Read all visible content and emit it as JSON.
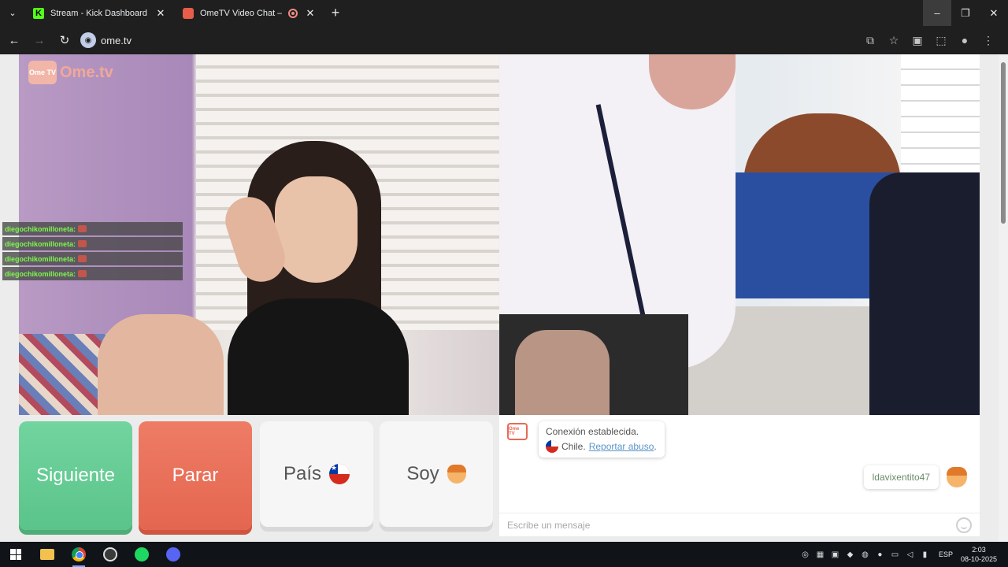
{
  "browser": {
    "tabs": [
      {
        "title": "Stream - Kick Dashboard",
        "favicon": "kick-icon"
      },
      {
        "title": "OmeTV Video Chat — Ome",
        "favicon": "ometv-icon",
        "recording": true
      }
    ],
    "url": "ome.tv",
    "window_controls": {
      "minimize": "–",
      "restore": "❐",
      "close": "✕"
    }
  },
  "page": {
    "logo": {
      "badge": "Ome TV",
      "wordmark": "Ome.tv"
    },
    "overlay_chat": [
      {
        "user": "diegochikomilloneta:"
      },
      {
        "user": "diegochikomilloneta:"
      },
      {
        "user": "diegochikomilloneta:"
      },
      {
        "user": "diegochikomilloneta:"
      }
    ],
    "controls": {
      "next": "Siguiente",
      "stop": "Parar",
      "country": "País",
      "me": "Soy"
    },
    "chat": {
      "system_logo": "Ome TV",
      "system_line1": "Conexión establecida.",
      "system_country": "Chile.",
      "report_link": "Reportar abuso",
      "report_suffix": ".",
      "user_message": "ldavixentito47",
      "input_placeholder": "Escribe un mensaje"
    },
    "colors": {
      "next": "#5ac48a",
      "stop": "#e46650",
      "accent": "#e86a55"
    }
  },
  "taskbar": {
    "language": "ESP",
    "time": "2:03",
    "date": "08-10-2025"
  }
}
